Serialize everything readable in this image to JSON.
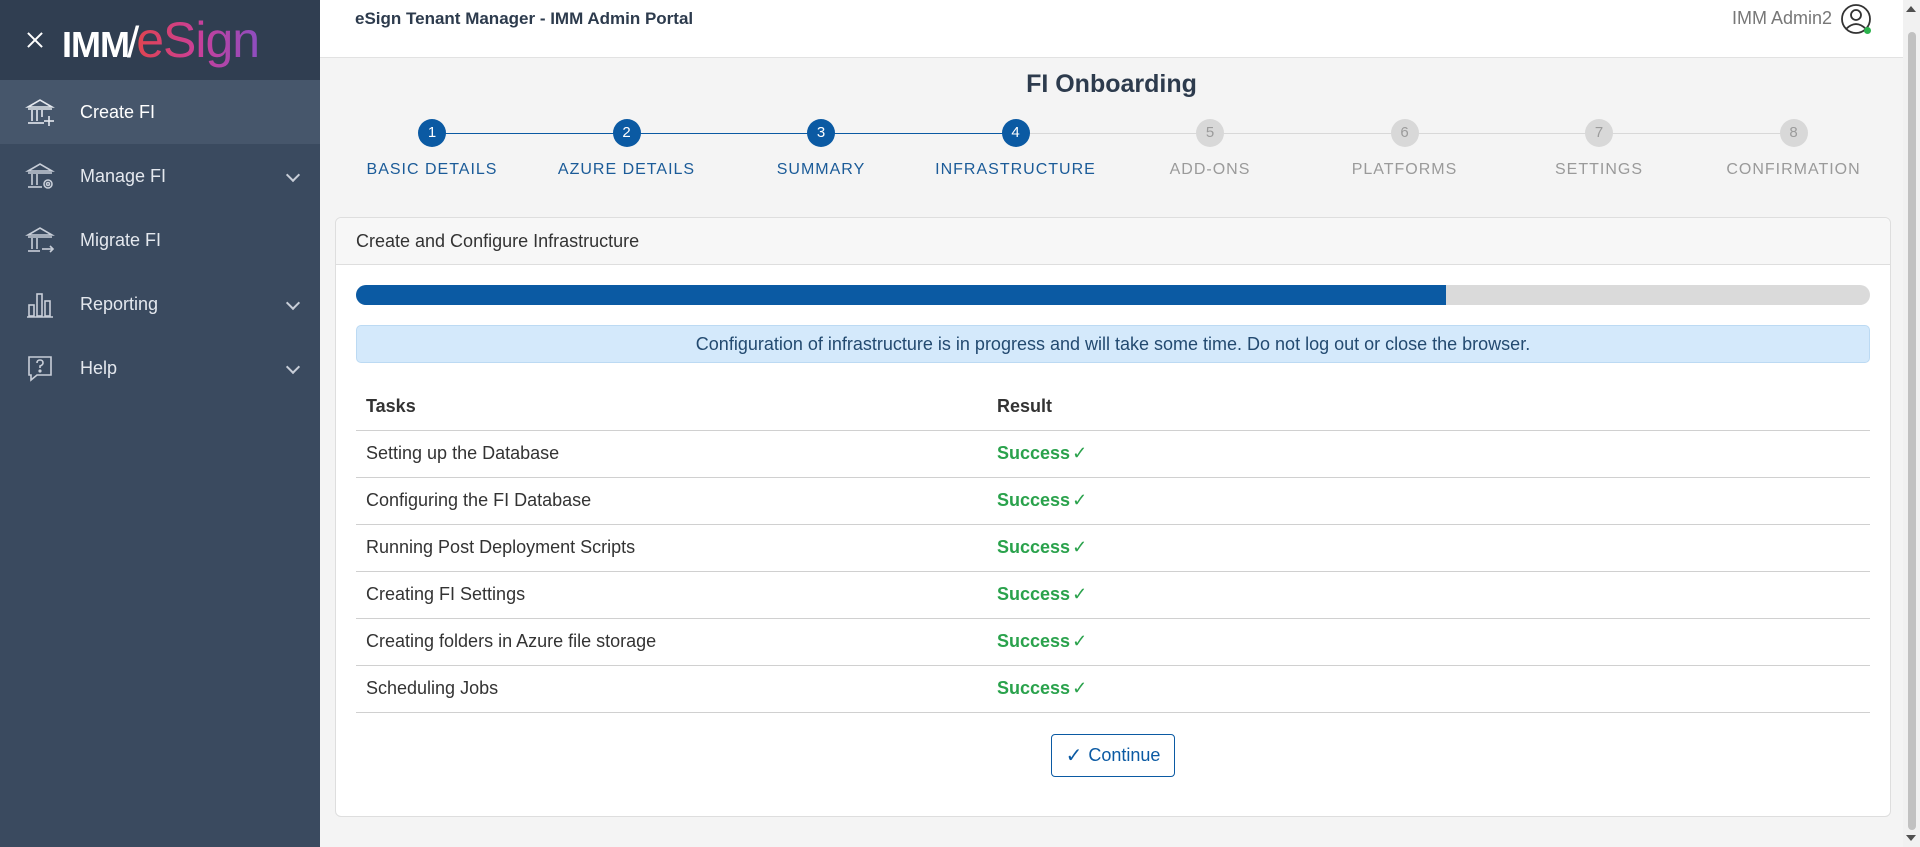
{
  "sidebar": {
    "logo_left": "IMM",
    "logo_slash": "/",
    "logo_right": "eSign",
    "items": [
      {
        "label": "Create FI",
        "icon": "bank-plus-icon",
        "active": true
      },
      {
        "label": "Manage FI",
        "icon": "bank-gear-icon",
        "expandable": true
      },
      {
        "label": "Migrate FI",
        "icon": "bank-arrow-icon"
      },
      {
        "label": "Reporting",
        "icon": "bar-chart-icon",
        "expandable": true
      },
      {
        "label": "Help",
        "icon": "question-bubble-icon",
        "expandable": true
      }
    ]
  },
  "header": {
    "title": "eSign Tenant Manager - IMM Admin Portal",
    "user_name": "IMM Admin2",
    "status_color": "#2bb24c"
  },
  "page": {
    "title": "FI Onboarding"
  },
  "stepper": {
    "current": 4,
    "steps": [
      {
        "number": "1",
        "label": "BASIC DETAILS"
      },
      {
        "number": "2",
        "label": "AZURE DETAILS"
      },
      {
        "number": "3",
        "label": "SUMMARY"
      },
      {
        "number": "4",
        "label": "INFRASTRUCTURE"
      },
      {
        "number": "5",
        "label": "ADD-ONS"
      },
      {
        "number": "6",
        "label": "PLATFORMS"
      },
      {
        "number": "7",
        "label": "SETTINGS"
      },
      {
        "number": "8",
        "label": "CONFIRMATION"
      }
    ]
  },
  "card": {
    "header": "Create and Configure Infrastructure",
    "progress_fraction": 0.72,
    "alert": "Configuration of infrastructure is in progress and will take some time. Do not log out or close the browser.",
    "table": {
      "headers": [
        "Tasks",
        "Result"
      ],
      "rows": [
        {
          "task": "Setting up the Database",
          "result": "Success",
          "mark": "✓"
        },
        {
          "task": "Configuring the FI Database",
          "result": "Success",
          "mark": "✓"
        },
        {
          "task": "Running Post Deployment Scripts",
          "result": "Success",
          "mark": "✓"
        },
        {
          "task": "Creating FI Settings",
          "result": "Success",
          "mark": "✓"
        },
        {
          "task": "Creating folders in Azure file storage",
          "result": "Success",
          "mark": "✓"
        },
        {
          "task": "Scheduling Jobs",
          "result": "Success",
          "mark": "✓"
        }
      ]
    },
    "continue_check": "✓",
    "continue_label": "Continue"
  },
  "colors": {
    "primary": "#0b5aa3",
    "sidebar_bg": "#3a4a5f",
    "success": "#2aa24c",
    "inactive_step": "#d8d8d8"
  }
}
